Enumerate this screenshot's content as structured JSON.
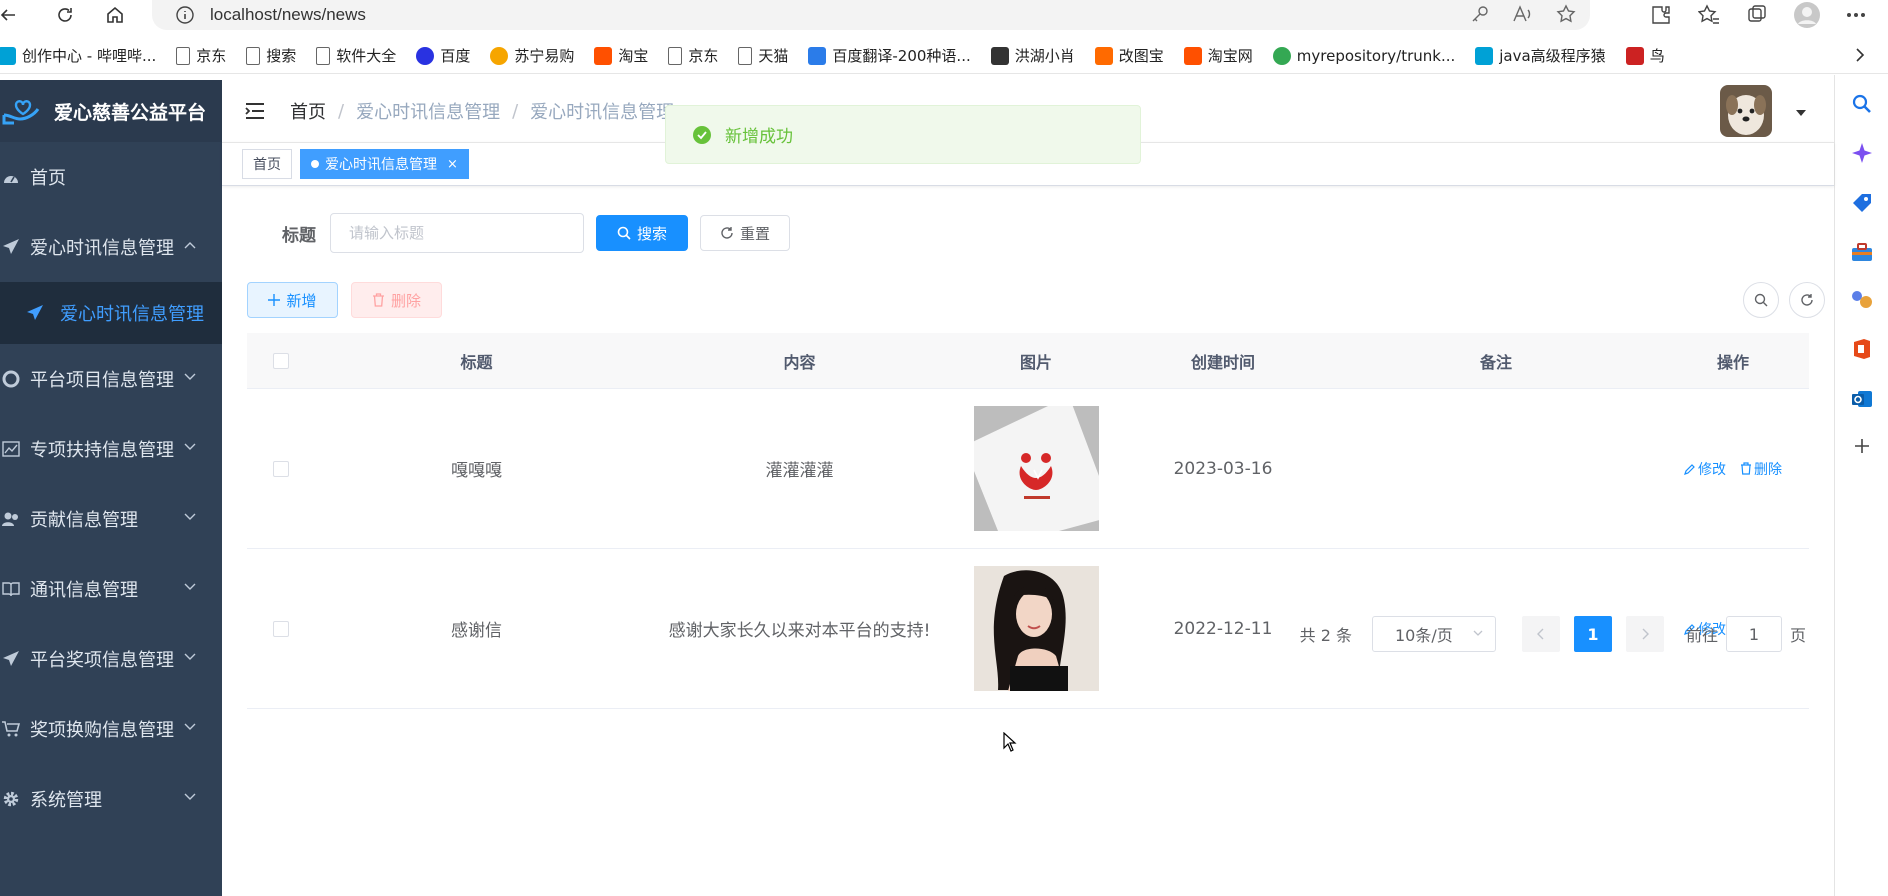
{
  "browser": {
    "url": "localhost/news/news",
    "bookmarks": [
      {
        "label": "创作中心 - 哔哩哔...",
        "icon": "bilibili-icon",
        "color": "#00a1d6"
      },
      {
        "label": "京东",
        "icon": "page-icon",
        "color": "#666666"
      },
      {
        "label": "搜索",
        "icon": "page-icon",
        "color": "#666666"
      },
      {
        "label": "软件大全",
        "icon": "page-icon",
        "color": "#666666"
      },
      {
        "label": "百度",
        "icon": "baidu-icon",
        "color": "#2932e1"
      },
      {
        "label": "苏宁易购",
        "icon": "suning-icon",
        "color": "#f6a500"
      },
      {
        "label": "淘宝",
        "icon": "taobao-icon",
        "color": "#ff5000"
      },
      {
        "label": "京东",
        "icon": "page-icon",
        "color": "#666666"
      },
      {
        "label": "天猫",
        "icon": "page-icon",
        "color": "#666666"
      },
      {
        "label": "百度翻译-200种语...",
        "icon": "translate-icon",
        "color": "#2b7ce9"
      },
      {
        "label": "洪湖小肖",
        "icon": "bird-icon",
        "color": "#333333"
      },
      {
        "label": "改图宝",
        "icon": "gaitubao-icon",
        "color": "#ff6a00"
      },
      {
        "label": "淘宝网",
        "icon": "taobao-icon",
        "color": "#ff5000"
      },
      {
        "label": "myrepository/trunk...",
        "icon": "chrome-icon",
        "color": "#34a853"
      },
      {
        "label": "java高级程序猿",
        "icon": "bilibili-icon",
        "color": "#00a1d6"
      },
      {
        "label": "鸟",
        "icon": "bird-icon",
        "color": "#cc2222"
      }
    ]
  },
  "app": {
    "title": "爱心慈善公益平台",
    "menu": [
      {
        "label": "首页",
        "icon": "dashboard-icon"
      },
      {
        "label": "爱心时讯信息管理",
        "icon": "send-icon",
        "expanded": true
      },
      {
        "label": "平台项目信息管理",
        "icon": "aperture-icon"
      },
      {
        "label": "专项扶持信息管理",
        "icon": "chart-icon"
      },
      {
        "label": "贡献信息管理",
        "icon": "peoples-icon"
      },
      {
        "label": "通讯信息管理",
        "icon": "book-icon"
      },
      {
        "label": "平台奖项信息管理",
        "icon": "send-icon"
      },
      {
        "label": "奖项换购信息管理",
        "icon": "cart-icon"
      },
      {
        "label": "系统管理",
        "icon": "gear-icon"
      }
    ],
    "submenu_active": "爱心时讯信息管理",
    "breadcrumb": [
      "首页",
      "爱心时讯信息管理",
      "爱心时讯信息管理"
    ],
    "tags": {
      "home": "首页",
      "active": "爱心时讯信息管理"
    },
    "toast": "新增成功",
    "search": {
      "label": "标题",
      "placeholder": "请输入标题",
      "search_btn": "搜索",
      "reset_btn": "重置"
    },
    "toolbar": {
      "add": "新增",
      "delete": "删除"
    },
    "table": {
      "headers": [
        "标题",
        "内容",
        "图片",
        "创建时间",
        "备注",
        "操作"
      ],
      "rows": [
        {
          "title": "嘎嘎嘎",
          "content": "灌灌灌灌",
          "image": "charity-logo",
          "created": "2023-03-16",
          "note": ""
        },
        {
          "title": "感谢信",
          "content": "感谢大家长久以来对本平台的支持!",
          "image": "portrait-photo",
          "created": "2022-12-11",
          "note": ""
        }
      ],
      "edit_label": "修改",
      "delete_label": "删除"
    },
    "pagination": {
      "total": "共 2 条",
      "page_size": "10条/页",
      "current": "1",
      "goto_prefix": "前往",
      "goto_value": "1",
      "goto_suffix": "页"
    },
    "colors": {
      "sidebar": "#304156",
      "primary": "#1890ff",
      "success": "#67c23a",
      "danger": "#ff4949"
    }
  }
}
